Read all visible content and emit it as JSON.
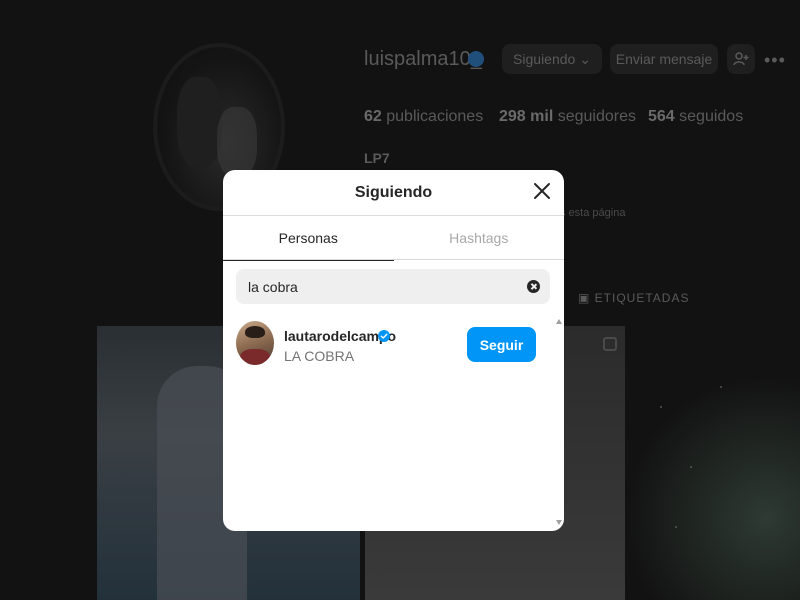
{
  "profile": {
    "username": "luispalma10_",
    "following_button": "Siguiendo",
    "message_button": "Enviar mensaje",
    "stats": {
      "posts": "62",
      "posts_label": "publicaciones",
      "followers": "298 mil",
      "followers_label": "seguidores",
      "following": "564",
      "following_label": "seguidos"
    },
    "full_name": "LP7",
    "page_note": "s esta página",
    "tagged_tab": "ETIQUETADAS"
  },
  "modal": {
    "title": "Siguiendo",
    "tabs": [
      {
        "label": "Personas",
        "active": true
      },
      {
        "label": "Hashtags",
        "active": false
      }
    ],
    "search": {
      "value": "la cobra"
    },
    "results": [
      {
        "handle": "lautarodelcampo",
        "verified": true,
        "full_name": "LA COBRA",
        "action_label": "Seguir"
      }
    ]
  },
  "icons": {
    "verified": "verified-badge-icon",
    "close": "close-icon",
    "clear": "clear-search-icon",
    "add_user": "add-user-icon",
    "more": "more-options-icon",
    "chevron": "chevron-down-icon"
  },
  "colors": {
    "accent": "#0095f6",
    "verified": "#0095f6",
    "overlay": "#121212"
  }
}
